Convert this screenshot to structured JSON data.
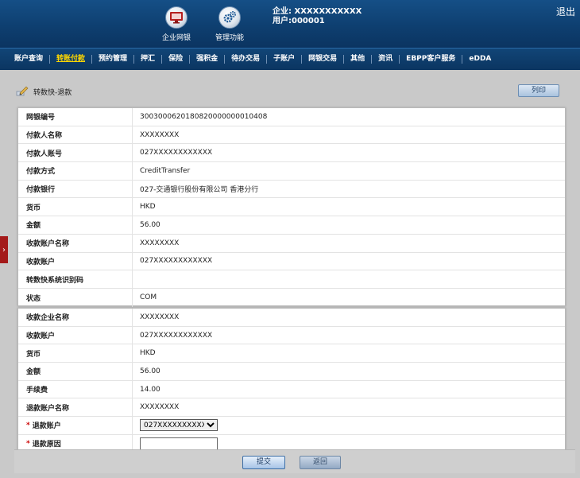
{
  "header": {
    "corp_banking_label": "企业网银",
    "mgmt_label": "管理功能",
    "company": "企业: XXXXXXXXXXX",
    "user": "用户:000001",
    "logout_label": "退出"
  },
  "nav": {
    "items": [
      {
        "label": "账户查询",
        "active": false
      },
      {
        "label": "转账付款",
        "active": true
      },
      {
        "label": "预约管理",
        "active": false
      },
      {
        "label": "押汇",
        "active": false
      },
      {
        "label": "保险",
        "active": false
      },
      {
        "label": "强积金",
        "active": false
      },
      {
        "label": "待办交易",
        "active": false
      },
      {
        "label": "子账户",
        "active": false
      },
      {
        "label": "网银交易",
        "active": false
      },
      {
        "label": "其他",
        "active": false
      },
      {
        "label": "资讯",
        "active": false
      },
      {
        "label": "EBPP客户服务",
        "active": false
      },
      {
        "label": "eDDA",
        "active": false
      }
    ]
  },
  "page": {
    "title": "转数快-退款",
    "print_label": "列印"
  },
  "original": [
    {
      "label": "网银编号",
      "value": "3003000620180820000000010408"
    },
    {
      "label": "付款人名称",
      "value": "XXXXXXXX"
    },
    {
      "label": "付款人账号",
      "value": "027XXXXXXXXXXXX"
    },
    {
      "label": "付款方式",
      "value": "CreditTransfer"
    },
    {
      "label": "付款银行",
      "value": "027-交通银行股份有限公司 香港分行"
    },
    {
      "label": "货币",
      "value": "HKD"
    },
    {
      "label": "金额",
      "value": "56.00"
    },
    {
      "label": "收款账户名称",
      "value": "XXXXXXXX"
    },
    {
      "label": "收款账户",
      "value": "027XXXXXXXXXXXX"
    },
    {
      "label": "转数快系统识别码",
      "value": ""
    },
    {
      "label": "状态",
      "value": "COM"
    }
  ],
  "refund": [
    {
      "label": "收款企业名称",
      "value": "XXXXXXXX"
    },
    {
      "label": "收款账户",
      "value": "027XXXXXXXXXXXX"
    },
    {
      "label": "货币",
      "value": "HKD"
    },
    {
      "label": "金额",
      "value": "56.00"
    },
    {
      "label": "手续费",
      "value": "14.00"
    },
    {
      "label": "退款账户名称",
      "value": "XXXXXXXX"
    }
  ],
  "form": {
    "refund_account_label": "退款账户",
    "refund_account_value": "027XXXXXXXXXXXX",
    "refund_reason_label": "退款原因",
    "refund_reason_value": "",
    "required_mark": "*"
  },
  "actions": {
    "submit_label": "提交",
    "back_label": "返回"
  },
  "colors": {
    "header_bg": "#0e3f70",
    "active_nav": "#ffd800",
    "side_tab": "#a41a1a"
  }
}
